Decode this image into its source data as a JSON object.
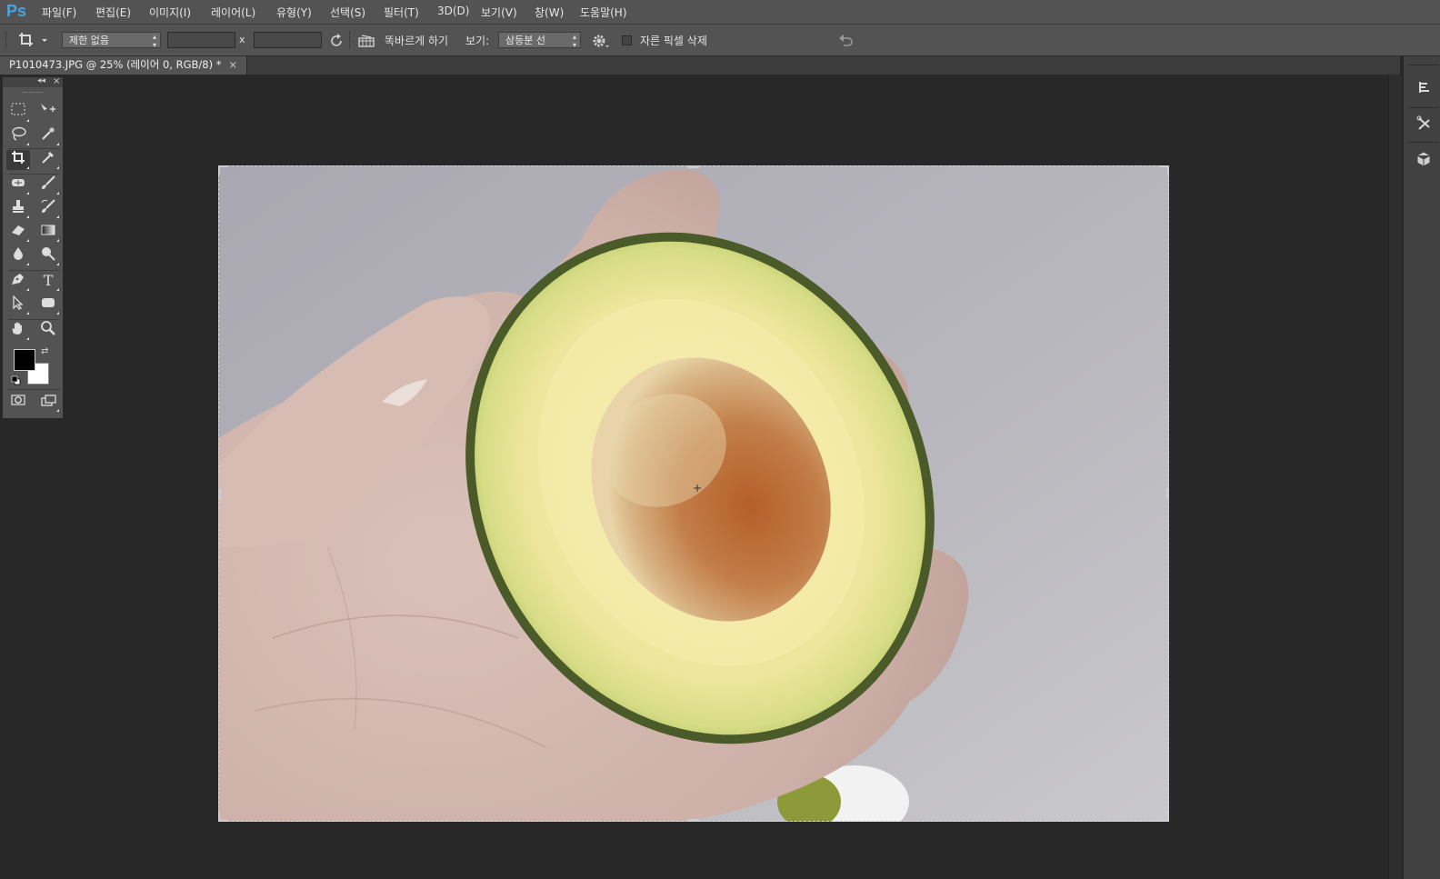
{
  "app": {
    "logo": "Ps"
  },
  "menu": [
    "파일(F)",
    "편집(E)",
    "이미지(I)",
    "레이어(L)",
    "유형(Y)",
    "선택(S)",
    "필터(T)",
    "3D(D)",
    "보기(V)",
    "창(W)",
    "도움말(H)"
  ],
  "options": {
    "ratio_select": "제한 없음",
    "times": "x",
    "straighten_label": "똑바르게 하기",
    "view_label": "보기:",
    "view_select": "삼등분 선",
    "delete_cropped_label": "자른 픽셀 삭제",
    "delete_cropped_checked": false,
    "tool_icon": "crop-icon",
    "swap_icon": "rotate-icon",
    "settings_icon": "gear-icon",
    "reset_icon": "undo-icon"
  },
  "document": {
    "tab_title": "P1010473.JPG @ 25% (레이어 0, RGB/8) *",
    "close": "×"
  },
  "toolbox": {
    "collapse": "◂◂",
    "close": "×",
    "tools": [
      "rectangular-marquee",
      "move",
      "lasso",
      "magic-wand",
      "crop",
      "eyedropper",
      "spot-healing",
      "brush",
      "clone-stamp",
      "history-brush",
      "eraser",
      "gradient",
      "blur",
      "dodge",
      "pen",
      "type",
      "path-selection",
      "rectangle",
      "hand",
      "zoom"
    ],
    "foreground_color": "#000000",
    "background_color": "#ffffff"
  },
  "colors": {
    "ui_panel": "#535353",
    "workspace": "#282828",
    "ps_blue": "#4aa3df"
  },
  "canvas": {
    "subject": "hand holding a halved avocado with pit",
    "crop_guides": "삼등분 선"
  }
}
